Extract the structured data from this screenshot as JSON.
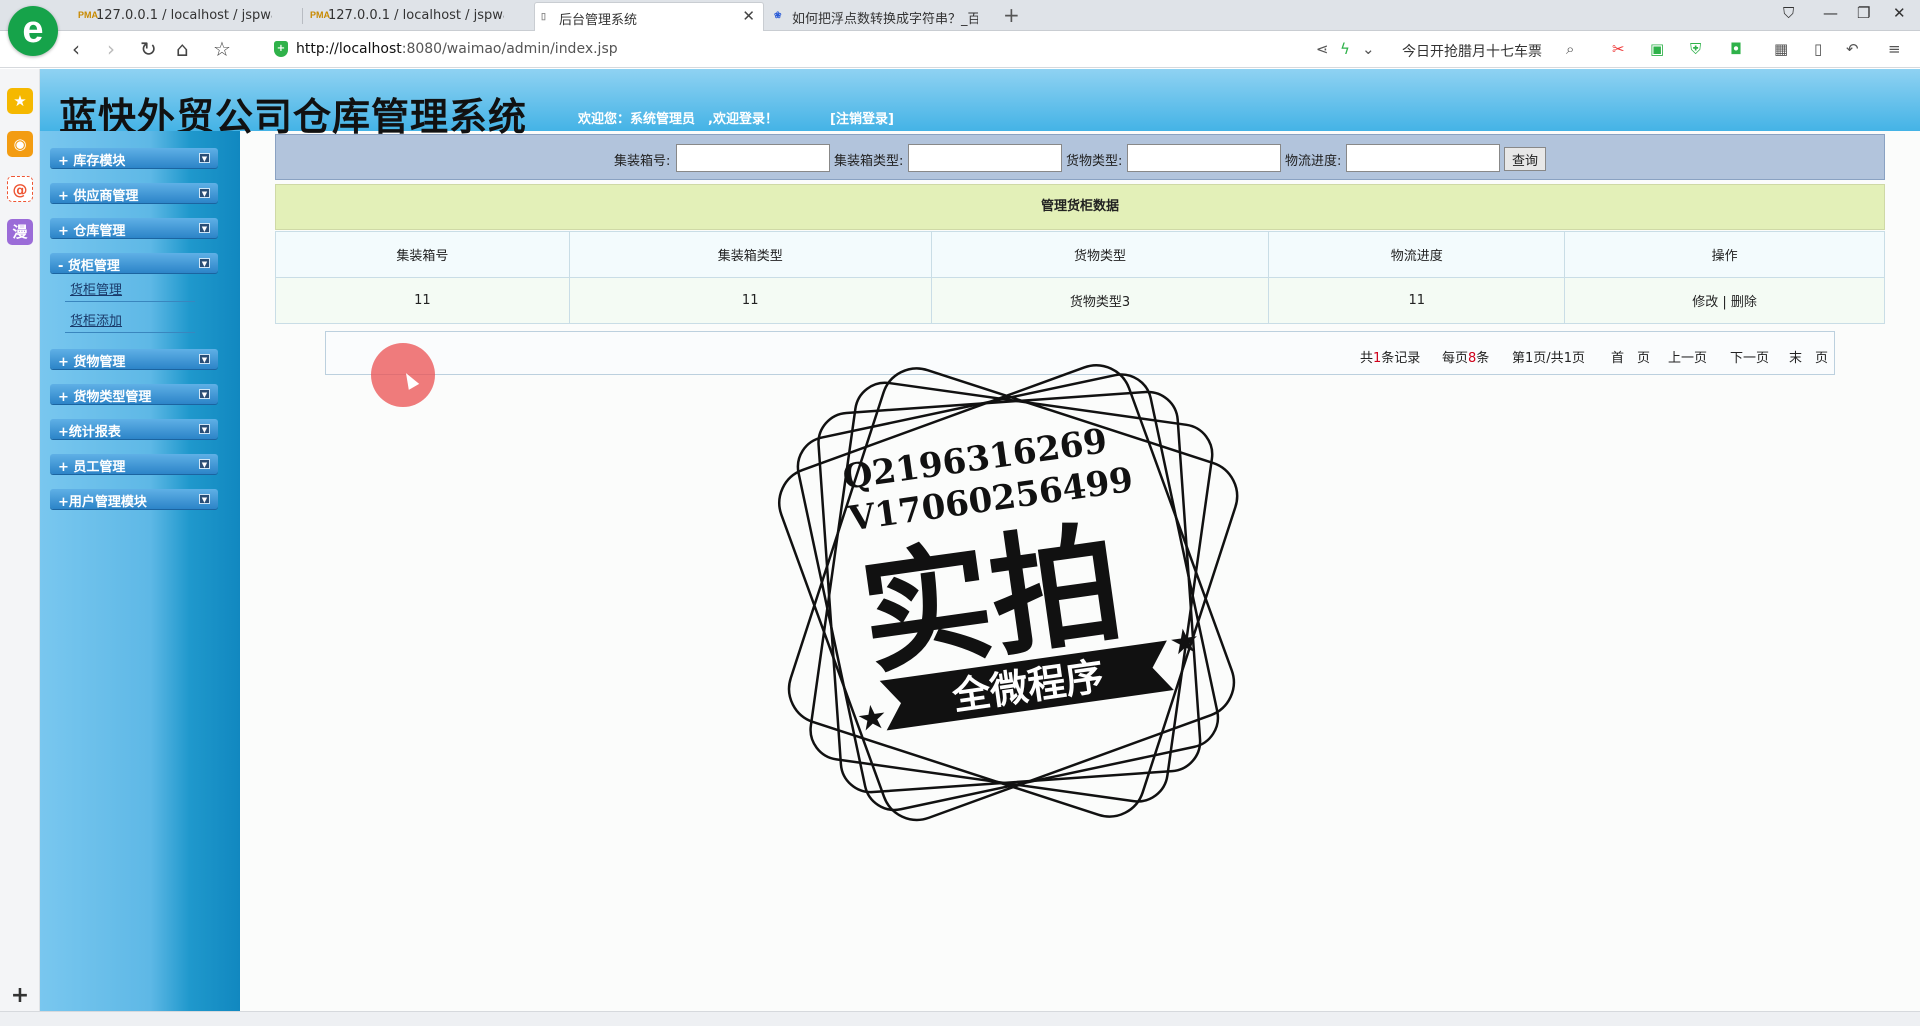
{
  "browser": {
    "tabs": [
      {
        "label": "127.0.0.1 / localhost / jspwaim",
        "icon": "phpmyadmin-icon"
      },
      {
        "label": "127.0.0.1 / localhost / jspwaim",
        "icon": "phpmyadmin-icon"
      },
      {
        "label": "后台管理系统",
        "icon": "page-icon"
      },
      {
        "label": "如何把浮点数转换成字符串？_百",
        "icon": "baidu-icon"
      }
    ],
    "active_tab": 2,
    "url_host": "http://localhost",
    "url_rest": ":8080/waimao/admin/index.jsp",
    "promo_text": "今日开抢腊月十七车票",
    "logo_letter": "e",
    "pma_text": "PMA"
  },
  "app": {
    "title": "蓝快外贸公司仓库管理系统",
    "welcome": "欢迎您：系统管理员　,欢迎登录！",
    "logout": "[注销登录]"
  },
  "menu": {
    "groups": [
      {
        "label": "+ 库存模块"
      },
      {
        "label": "+ 供应商管理"
      },
      {
        "label": "+ 仓库管理"
      },
      {
        "label": "- 货柜管理"
      },
      {
        "label": "+ 货物管理"
      },
      {
        "label": "+ 货物类型管理"
      },
      {
        "label": "+统计报表"
      },
      {
        "label": "+ 员工管理"
      },
      {
        "label": "+用户管理模块"
      }
    ],
    "subitems": [
      {
        "label": "货柜管理"
      },
      {
        "label": "货柜添加"
      }
    ]
  },
  "search": {
    "fields": [
      {
        "label": "集装箱号:",
        "value": ""
      },
      {
        "label": "集装箱类型:",
        "value": ""
      },
      {
        "label": "货物类型:",
        "value": ""
      },
      {
        "label": "物流进度:",
        "value": ""
      }
    ],
    "button": "查询"
  },
  "grid": {
    "title": "管理货柜数据",
    "columns": [
      "集装箱号",
      "集装箱类型",
      "货物类型",
      "物流进度",
      "操作"
    ],
    "rows": [
      {
        "cells": [
          "11",
          "11",
          "货物类型3",
          "11"
        ],
        "edit": "修改",
        "sep": "|",
        "delete": "删除"
      }
    ]
  },
  "pager": {
    "total_prefix": "共",
    "total": "1",
    "total_suffix": "条记录",
    "per_prefix": "每页",
    "per": "8",
    "per_suffix": "条",
    "page_prefix": "第",
    "page": "1",
    "page_mid": "页/共",
    "pages": "1",
    "page_suffix": "页",
    "first": "首　页",
    "prev": "上一页",
    "next": "下一页",
    "last": "末　页"
  },
  "watermark": {
    "qq": "Q2196316269",
    "wx": "V17060256499",
    "main": "实拍",
    "banner": "全微程序"
  }
}
